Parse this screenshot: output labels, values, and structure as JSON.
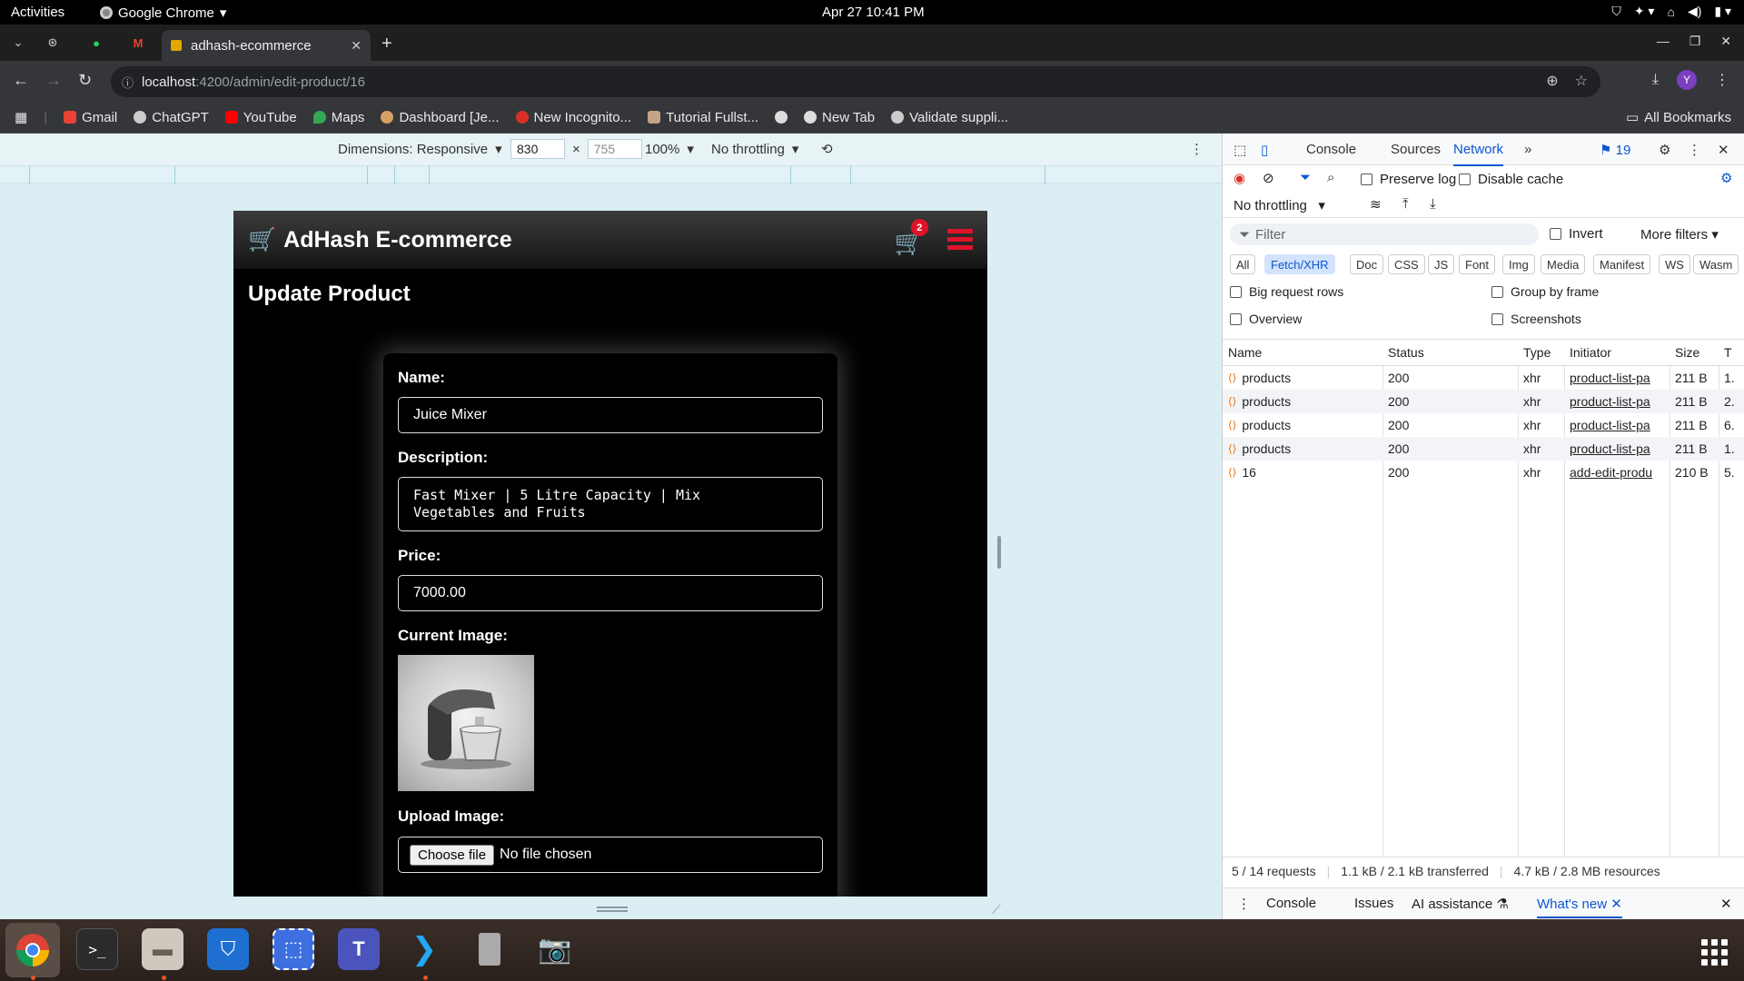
{
  "topbar": {
    "activities": "Activities",
    "app_menu": "Google Chrome",
    "clock": "Apr 27  10:41 PM"
  },
  "browser": {
    "tab_title": "adhash-ecommerce",
    "url_host": "localhost",
    "url_path": ":4200/admin/edit-product/16",
    "profile_initial": "Y"
  },
  "bookmarks": [
    {
      "label": "Gmail",
      "color": "#ea4335"
    },
    {
      "label": "ChatGPT",
      "color": "#cccccc"
    },
    {
      "label": "YouTube",
      "color": "#ff0000"
    },
    {
      "label": "Maps",
      "color": "#34a853"
    },
    {
      "label": "Dashboard [Je...",
      "color": "#d9a066"
    },
    {
      "label": "New Incognito...",
      "color": "#d93025"
    },
    {
      "label": "Tutorial Fullst...",
      "color": "#c4a484"
    },
    {
      "label": "",
      "color": "#dddddd"
    },
    {
      "label": "New Tab",
      "color": "#dddddd"
    },
    {
      "label": "Validate suppli...",
      "color": "#cccccc"
    }
  ],
  "all_bookmarks": "All Bookmarks",
  "device_toolbar": {
    "dimensions_label": "Dimensions: Responsive",
    "width": "830",
    "height": "755",
    "zoom": "100%",
    "throttling": "No throttling"
  },
  "site": {
    "brand": "AdHash E-commerce",
    "cart_count": "2",
    "page_title": "Update Product",
    "form": {
      "name_label": "Name:",
      "name_value": "Juice Mixer",
      "description_label": "Description:",
      "description_value": "Fast Mixer | 5 Litre Capacity | Mix\nVegetables and Fruits",
      "price_label": "Price:",
      "price_value": "7000.00",
      "current_image_label": "Current Image:",
      "upload_label": "Upload Image:",
      "choose_file": "Choose file",
      "no_file": "No file chosen"
    }
  },
  "devtools": {
    "tabs": [
      "Console",
      "Sources",
      "Network"
    ],
    "active_tab": "Network",
    "issues_count": "19",
    "preserve_log": "Preserve log",
    "disable_cache": "Disable cache",
    "throttling": "No throttling",
    "filter_placeholder": "Filter",
    "invert": "Invert",
    "more_filters": "More filters",
    "type_filters": [
      "All",
      "Fetch/XHR",
      "Doc",
      "CSS",
      "JS",
      "Font",
      "Img",
      "Media",
      "Manifest",
      "WS",
      "Wasm"
    ],
    "active_filter": "Fetch/XHR",
    "options": {
      "big_rows": "Big request rows",
      "group_by_frame": "Group by frame",
      "overview": "Overview",
      "screenshots": "Screenshots"
    },
    "columns": [
      "Name",
      "Status",
      "Type",
      "Initiator",
      "Size",
      "T"
    ],
    "requests": [
      {
        "name": "products",
        "status": "200",
        "type": "xhr",
        "initiator": "product-list-pa",
        "size": "211 B",
        "time": "1."
      },
      {
        "name": "products",
        "status": "200",
        "type": "xhr",
        "initiator": "product-list-pa",
        "size": "211 B",
        "time": "2."
      },
      {
        "name": "products",
        "status": "200",
        "type": "xhr",
        "initiator": "product-list-pa",
        "size": "211 B",
        "time": "6."
      },
      {
        "name": "products",
        "status": "200",
        "type": "xhr",
        "initiator": "product-list-pa",
        "size": "211 B",
        "time": "1."
      },
      {
        "name": "16",
        "status": "200",
        "type": "xhr",
        "initiator": "add-edit-produ",
        "size": "210 B",
        "time": "5."
      }
    ],
    "summary": {
      "requests": "5 / 14 requests",
      "transferred": "1.1 kB / 2.1 kB transferred",
      "resources": "4.7 kB / 2.8 MB resources"
    },
    "drawer_tabs": [
      "Console",
      "Issues",
      "AI assistance",
      "What's new"
    ]
  },
  "colors": {
    "accent_red": "#e0132a",
    "devtools_blue": "#0b57d0",
    "page_bg": "#000000"
  }
}
